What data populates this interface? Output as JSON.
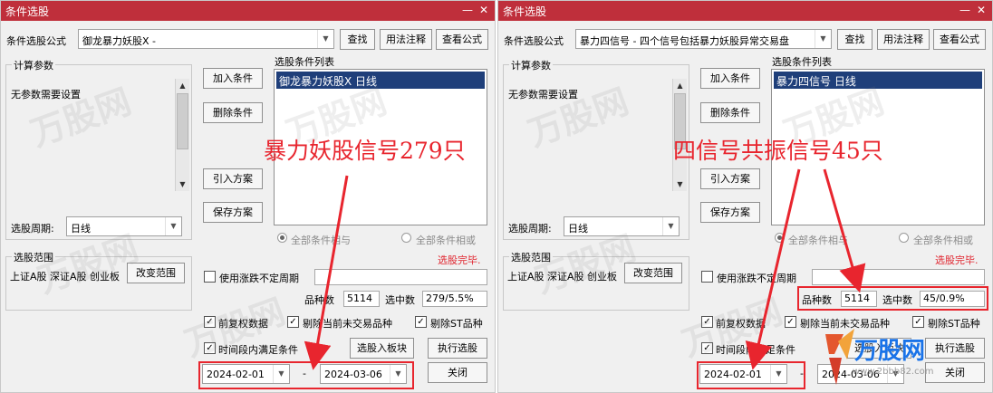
{
  "dialogs": [
    {
      "title": "条件选股",
      "formula_label": "条件选股公式",
      "formula_value": "御龙暴力妖股X  -",
      "find_label": "查找",
      "usage_label": "用法注释",
      "view_label": "查看公式",
      "params_group": "计算参数",
      "params_text": "无参数需要设置",
      "list_title": "选股条件列表",
      "list_item": "御龙暴力妖股X  日线",
      "add_label": "加入条件",
      "del_label": "删除条件",
      "import_label": "引入方案",
      "save_label": "保存方案",
      "period_label": "选股周期:",
      "period_value": "日线",
      "all_cond_label": "全部条件相与",
      "all_cond_or_label": "全部条件相或",
      "status": "选股完毕.",
      "range_group": "选股范围",
      "range_text": "上证A股 深证A股 创业板",
      "change_range_label": "改变范围",
      "use_period_label": "使用涨跌不定周期",
      "count_label": "品种数",
      "count_value": "5114",
      "selected_label": "选中数",
      "selected_value": "279/5.5%",
      "pre_adjust_label": "前复权数据",
      "exclude_label": "剔除当前未交易品种",
      "exclude_st_label": "剔除ST品种",
      "time_cond_label": "时间段内满足条件",
      "to_sector_label": "选股入板块",
      "execute_label": "执行选股",
      "date_from": "2024-02-01",
      "date_sep": "-",
      "date_to": "2024-03-06",
      "close_label": "关闭",
      "annotation": "暴力妖股信号279只",
      "annotation_color": "#e8252e",
      "titlebar_color": "#bf2f3b"
    },
    {
      "title": "条件选股",
      "formula_label": "条件选股公式",
      "formula_value": "暴力四信号  -  四个信号包括暴力妖股异常交易盘",
      "find_label": "查找",
      "usage_label": "用法注释",
      "view_label": "查看公式",
      "params_group": "计算参数",
      "params_text": "无参数需要设置",
      "list_title": "选股条件列表",
      "list_item": "暴力四信号  日线",
      "add_label": "加入条件",
      "del_label": "删除条件",
      "import_label": "引入方案",
      "save_label": "保存方案",
      "period_label": "选股周期:",
      "period_value": "日线",
      "all_cond_label": "全部条件相与",
      "all_cond_or_label": "全部条件相或",
      "status": "选股完毕.",
      "range_group": "选股范围",
      "range_text": "上证A股 深证A股 创业板",
      "change_range_label": "改变范围",
      "use_period_label": "使用涨跌不定周期",
      "count_label": "品种数",
      "count_value": "5114",
      "selected_label": "选中数",
      "selected_value": "45/0.9%",
      "pre_adjust_label": "前复权数据",
      "exclude_label": "剔除当前未交易品种",
      "exclude_st_label": "剔除ST品种",
      "time_cond_label": "时间段内满足条件",
      "to_sector_label": "选股入板块",
      "execute_label": "执行选股",
      "date_from": "2024-02-01",
      "date_sep": "-",
      "date_to": "2024-03-06",
      "close_label": "关闭",
      "annotation": "四信号共振信号45只",
      "annotation_color": "#e8252e",
      "titlebar_color": "#bf2f3b"
    }
  ],
  "watermark": {
    "brand": "万股网",
    "url": "www.2bbb82.com"
  },
  "window_controls": {
    "minimize_icon": "minimize-icon",
    "close_icon": "close-icon"
  }
}
